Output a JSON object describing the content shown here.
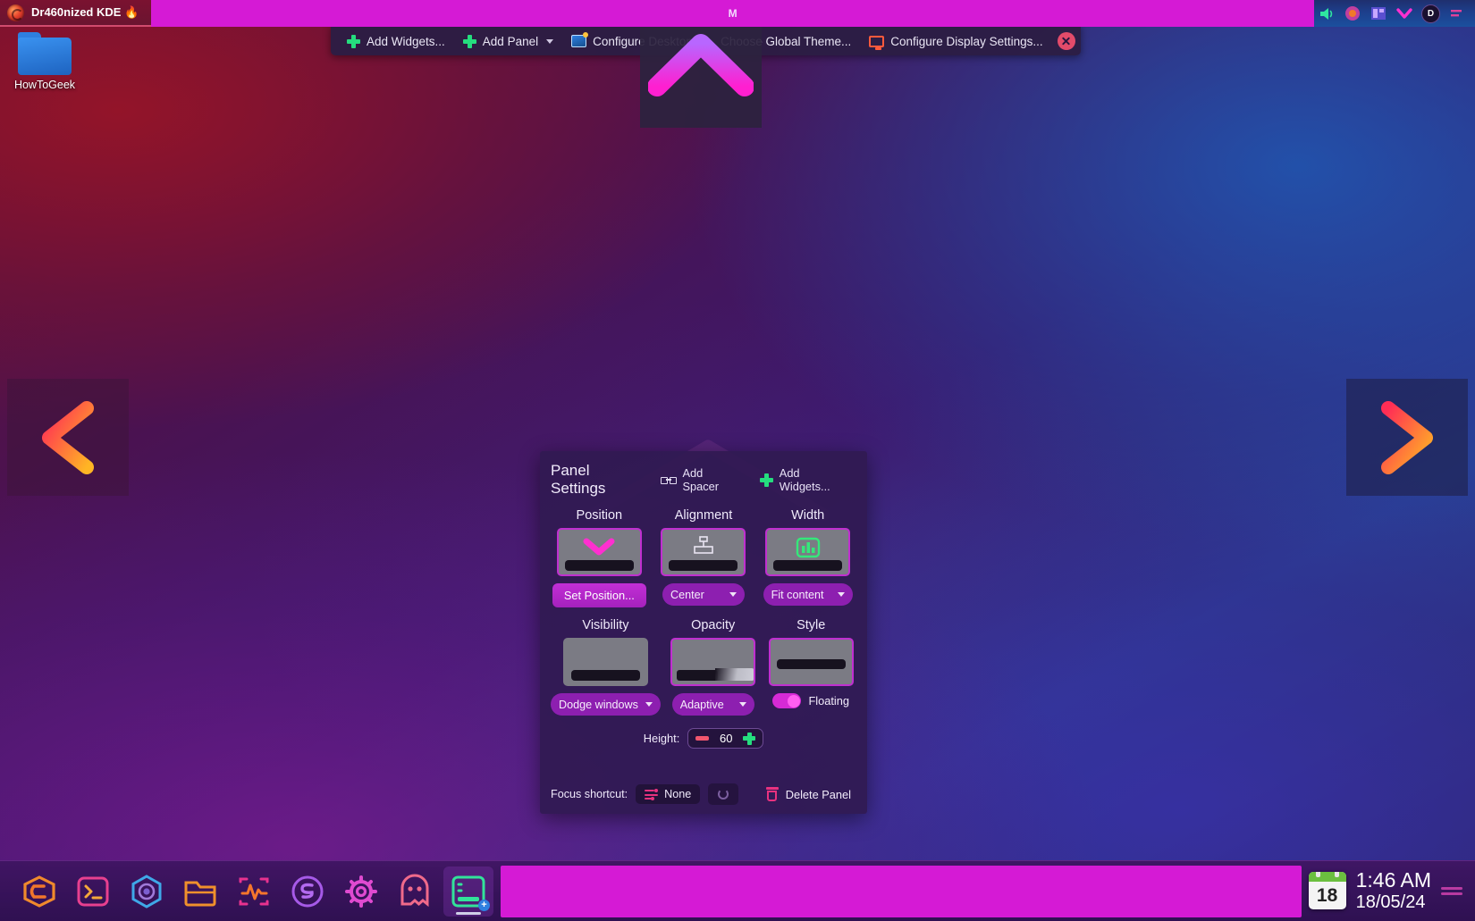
{
  "window_entry": {
    "title": "Dr460nized KDE 🔥",
    "icon": "dragon-icon"
  },
  "active_task": {
    "title": "M"
  },
  "tray": [
    {
      "name": "volume-icon",
      "glyph": "🔊"
    },
    {
      "name": "network-icon",
      "glyph": "◉"
    },
    {
      "name": "clipboard-icon",
      "glyph": "▤"
    },
    {
      "name": "chevron-down-icon",
      "glyph": "⌄"
    },
    {
      "name": "user-avatar",
      "glyph": "D"
    },
    {
      "name": "pin-icon",
      "glyph": "⇥"
    }
  ],
  "desktop_toolbar": {
    "items": [
      {
        "label": "Add Widgets...",
        "icon": "plus-icon"
      },
      {
        "label": "Add Panel",
        "icon": "plus-icon",
        "has_chevron": true
      },
      {
        "label": "Configure Desktop...",
        "icon": "wallpaper-icon"
      },
      {
        "label": "Choose Global Theme...",
        "icon": "theme-icon"
      },
      {
        "label": "Configure Display Settings...",
        "icon": "monitor-icon"
      }
    ],
    "close_label": "×"
  },
  "desktop_icons": [
    {
      "label": "HowToGeek",
      "icon": "folder-icon"
    }
  ],
  "pager": {
    "prev_label": "previous-desktop",
    "next_label": "next-desktop"
  },
  "panel_settings": {
    "title": "Panel Settings",
    "add_spacer_label": "Add Spacer",
    "add_widgets_label": "Add Widgets...",
    "position": {
      "label": "Position",
      "button": "Set Position...",
      "tile_icon": "chevron-down-icon"
    },
    "alignment": {
      "label": "Alignment",
      "value": "Center",
      "tile_icon": "align-center-icon"
    },
    "width": {
      "label": "Width",
      "value": "Fit content",
      "tile_icon": "fit-content-icon"
    },
    "visibility": {
      "label": "Visibility",
      "value": "Dodge windows",
      "tile_icon": "dodge-windows-icon"
    },
    "opacity": {
      "label": "Opacity",
      "value": "Adaptive",
      "tile_icon": "adaptive-opacity-icon"
    },
    "style": {
      "label": "Style",
      "value": "Floating",
      "toggle_on": true,
      "tile_icon": "floating-icon"
    },
    "height": {
      "label": "Height:",
      "value": "60",
      "minus": "−",
      "plus": "+"
    },
    "focus_shortcut": {
      "label": "Focus shortcut:",
      "value": "None"
    },
    "delete_panel": "Delete Panel"
  },
  "dock": {
    "launchers": [
      {
        "name": "application-launcher",
        "icon": "dragon-launcher-icon"
      },
      {
        "name": "terminal",
        "icon": "terminal-icon"
      },
      {
        "name": "web-browser",
        "icon": "browser-icon"
      },
      {
        "name": "file-manager",
        "icon": "folder-icon"
      },
      {
        "name": "system-monitor",
        "icon": "pulse-icon"
      },
      {
        "name": "spotify",
        "icon": "spotify-s-icon"
      },
      {
        "name": "system-settings",
        "icon": "gear-icon"
      },
      {
        "name": "ghostwriter",
        "icon": "ghost-icon"
      },
      {
        "name": "add-panel",
        "icon": "panel-add-icon",
        "active": true
      }
    ],
    "clock": {
      "day": "18",
      "time": "1:46 AM",
      "date": "18/05/24"
    }
  },
  "colors": {
    "accent_magenta": "#d51ad5",
    "accent_green": "#25dd7e",
    "accent_pink": "#e8327f",
    "panel_bg": "#301a52",
    "top_panel_blue": "#1d3f8c"
  }
}
